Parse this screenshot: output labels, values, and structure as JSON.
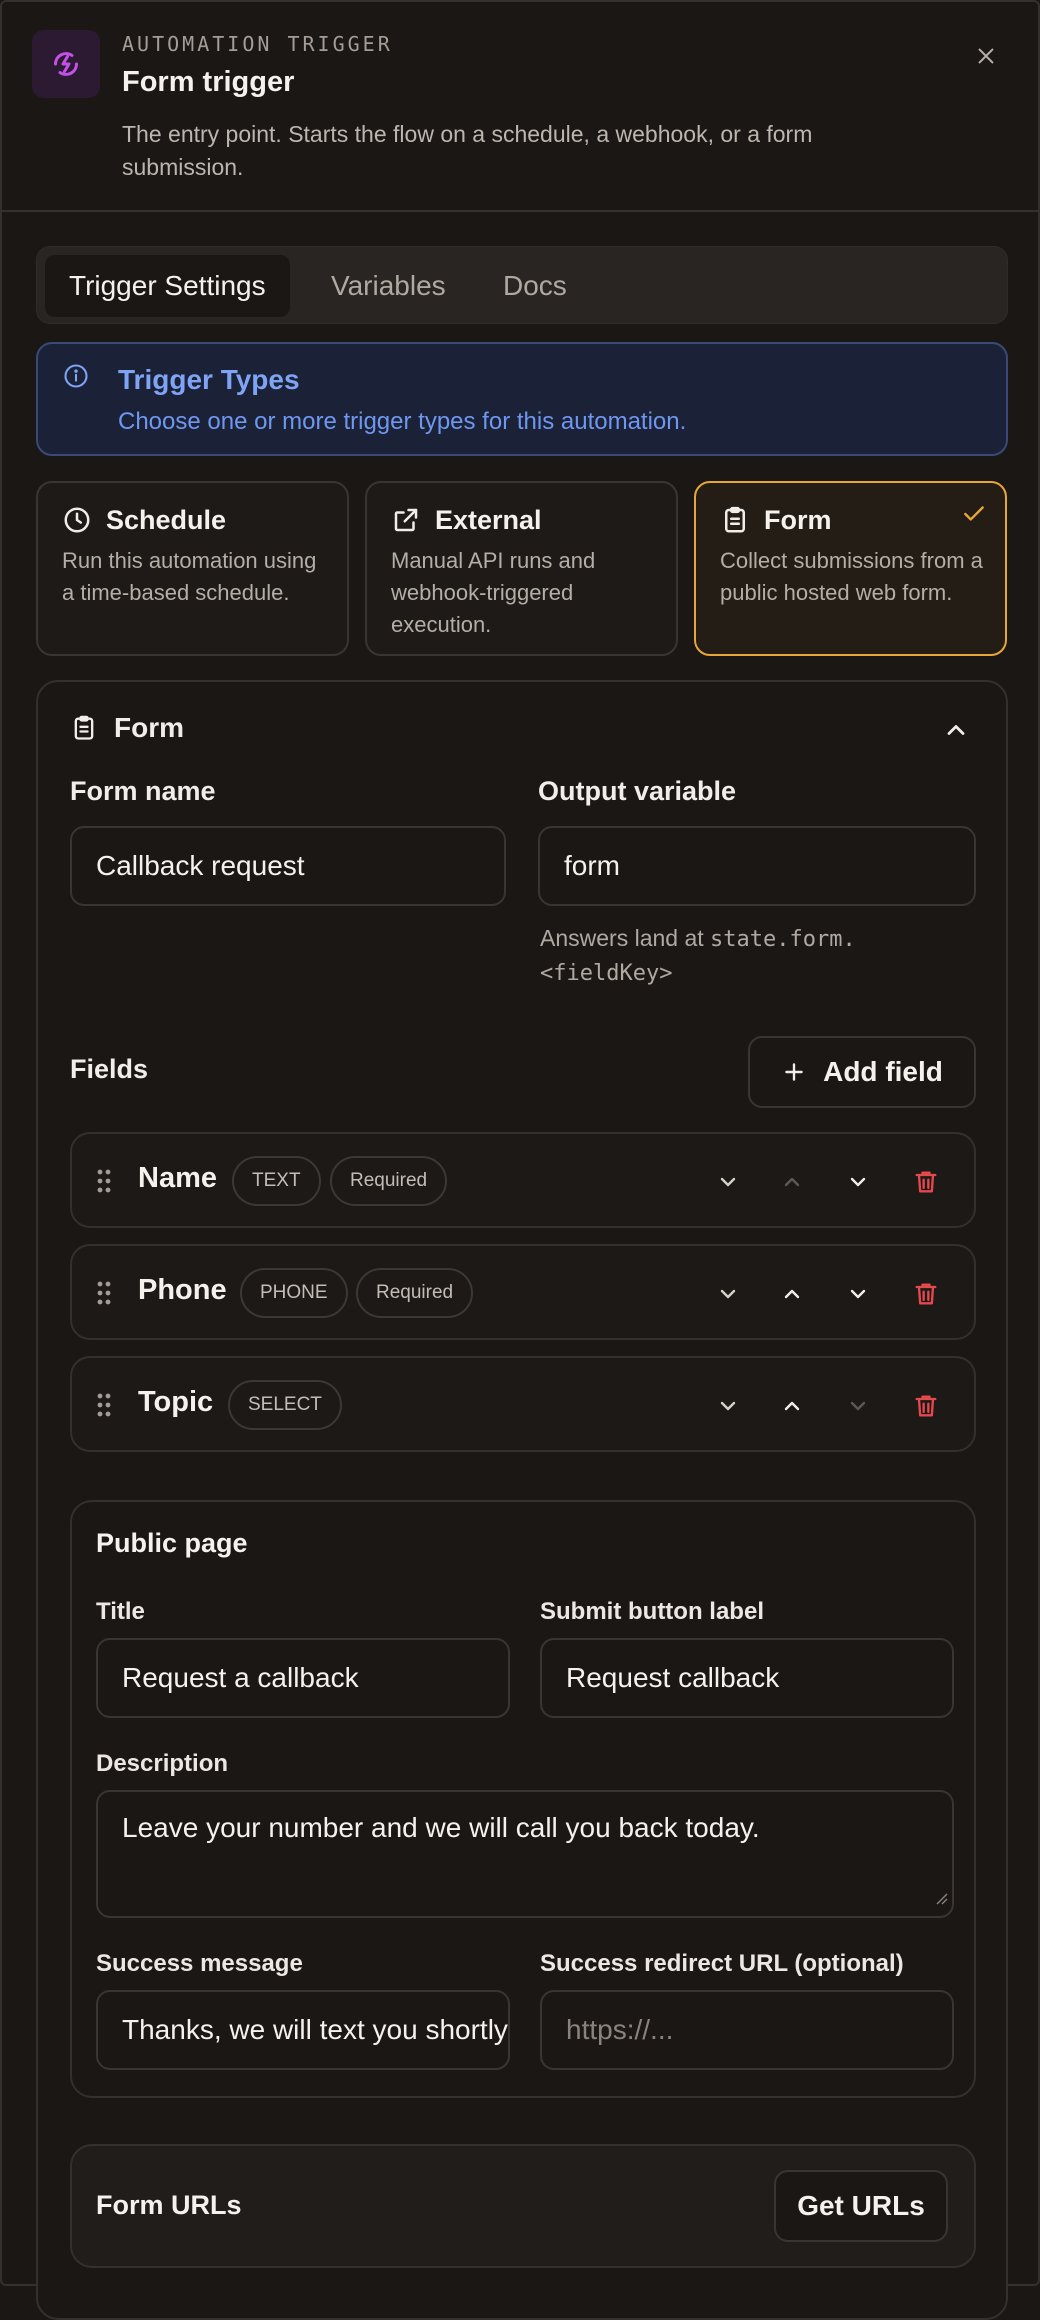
{
  "header": {
    "eyebrow": "AUTOMATION TRIGGER",
    "title": "Form trigger",
    "description": "The entry point. Starts the flow on a schedule, a webhook, or a form submission."
  },
  "tabs": [
    {
      "label": "Trigger Settings",
      "active": true
    },
    {
      "label": "Variables",
      "active": false
    },
    {
      "label": "Docs",
      "active": false
    }
  ],
  "alert": {
    "title": "Trigger Types",
    "description": "Choose one or more trigger types for this automation."
  },
  "trigger_types": [
    {
      "name": "Schedule",
      "description": "Run this automation using a time-based schedule.",
      "icon": "clock-icon",
      "selected": false
    },
    {
      "name": "External",
      "description": "Manual API runs and webhook-triggered execution.",
      "icon": "external-link-icon",
      "selected": false
    },
    {
      "name": "Form",
      "description": "Collect submissions from a public hosted web form.",
      "icon": "clipboard-icon",
      "selected": true
    }
  ],
  "form_section": {
    "title": "Form",
    "form_name_label": "Form name",
    "form_name_value": "Callback request",
    "output_variable_label": "Output variable",
    "output_variable_value": "form",
    "hint_prefix": "Answers land at ",
    "hint_code": "state.form.<fieldKey>",
    "fields_label": "Fields",
    "add_field_label": "Add field",
    "fields": [
      {
        "name": "Name",
        "type": "TEXT",
        "required_label": "Required",
        "required": true
      },
      {
        "name": "Phone",
        "type": "PHONE",
        "required_label": "Required",
        "required": true
      },
      {
        "name": "Topic",
        "type": "SELECT",
        "required_label": "",
        "required": false
      }
    ]
  },
  "public_page": {
    "title": "Public page",
    "title_label": "Title",
    "title_value": "Request a callback",
    "submit_label": "Submit button label",
    "submit_value": "Request callback",
    "description_label": "Description",
    "description_value": "Leave your number and we will call you back today.",
    "success_label": "Success message",
    "success_value": "Thanks, we will text you shortly.",
    "redirect_label": "Success redirect URL (optional)",
    "redirect_placeholder": "https://..."
  },
  "form_urls": {
    "title": "Form URLs",
    "button_label": "Get URLs"
  },
  "colors": {
    "background": "#1a1715",
    "accent": "#e8a63a",
    "info": "#7fa3f5",
    "danger": "#e5484d",
    "brand_icon": "#c550e8"
  }
}
